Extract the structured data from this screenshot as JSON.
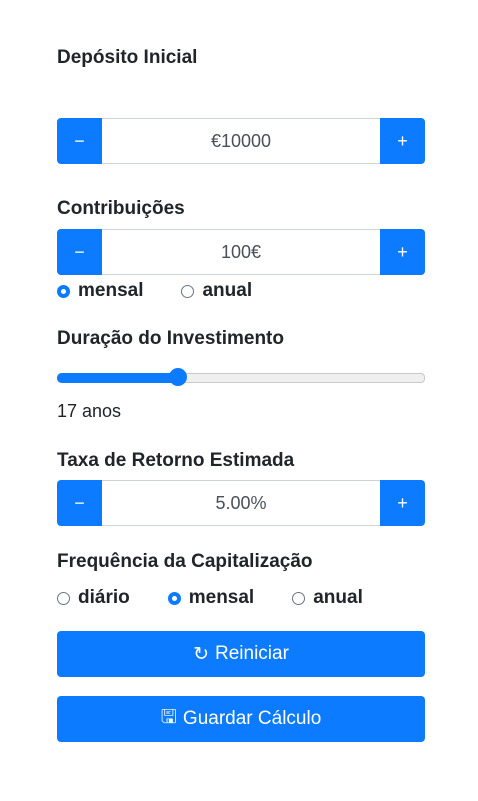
{
  "deposit": {
    "label": "Depósito Inicial",
    "value": "€10000",
    "minus": "−",
    "plus": "+"
  },
  "contributions": {
    "label": "Contribuições",
    "value": "100€",
    "minus": "−",
    "plus": "+",
    "options": [
      {
        "label": "mensal",
        "checked": true
      },
      {
        "label": "anual",
        "checked": false
      }
    ]
  },
  "duration": {
    "label": "Duração do Investimento",
    "value_text": "17 anos",
    "slider_fraction": 0.33
  },
  "rate": {
    "label": "Taxa de Retorno Estimada",
    "value": "5.00%",
    "minus": "−",
    "plus": "+"
  },
  "compounding": {
    "label": "Frequência da Capitalização",
    "options": [
      {
        "label": "diário",
        "checked": false
      },
      {
        "label": "mensal",
        "checked": true
      },
      {
        "label": "anual",
        "checked": false
      }
    ]
  },
  "buttons": {
    "reset_icon": "↻",
    "reset": "Reiniciar",
    "save_icon": "🖫",
    "save": "Guardar Cálculo"
  },
  "colors": {
    "accent": "#0d7bff"
  }
}
